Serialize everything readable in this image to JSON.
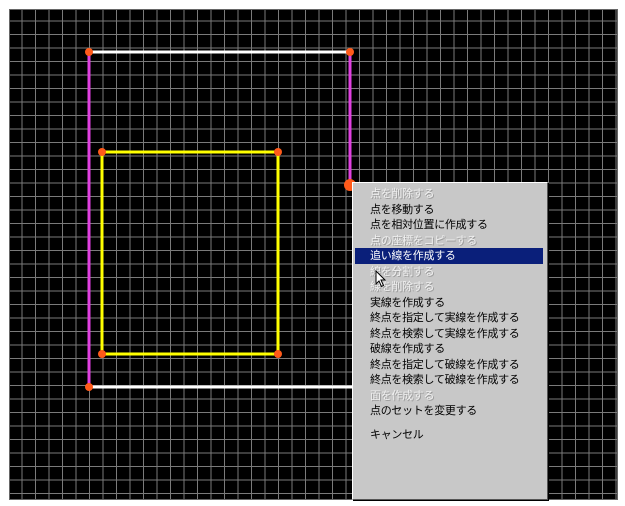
{
  "menu": {
    "items": [
      {
        "label": "点を削除する",
        "disabled": true
      },
      {
        "label": "点を移動する",
        "disabled": false
      },
      {
        "label": "点を相対位置に作成する",
        "disabled": false
      },
      {
        "label": "点の座標をコピーする",
        "disabled": true
      },
      {
        "label": "追い線を作成する",
        "disabled": false,
        "selected": true
      },
      {
        "label": "線を分割する",
        "disabled": true
      },
      {
        "label": "線を削除する",
        "disabled": true
      },
      {
        "label": "実線を作成する",
        "disabled": false
      },
      {
        "label": "終点を指定して実線を作成する",
        "disabled": false
      },
      {
        "label": "終点を検索して実線を作成する",
        "disabled": false
      },
      {
        "label": "破線を作成する",
        "disabled": false
      },
      {
        "label": "終点を指定して破線を作成する",
        "disabled": false
      },
      {
        "label": "終点を検索して破線を作成する",
        "disabled": false
      },
      {
        "label": "面を作成する",
        "disabled": true
      },
      {
        "label": "点のセットを変更する",
        "disabled": false
      }
    ],
    "cancel_label": "キャンセル"
  },
  "colors": {
    "background": "#000000",
    "grid": "#7a7a7a",
    "white_line": "#ffffff",
    "magenta_line": "#e040e0",
    "yellow_line": "#ffff00",
    "vertex": "#ff5a1a",
    "menu_bg": "#c8c8c8",
    "menu_highlight": "#0a1f7a"
  }
}
